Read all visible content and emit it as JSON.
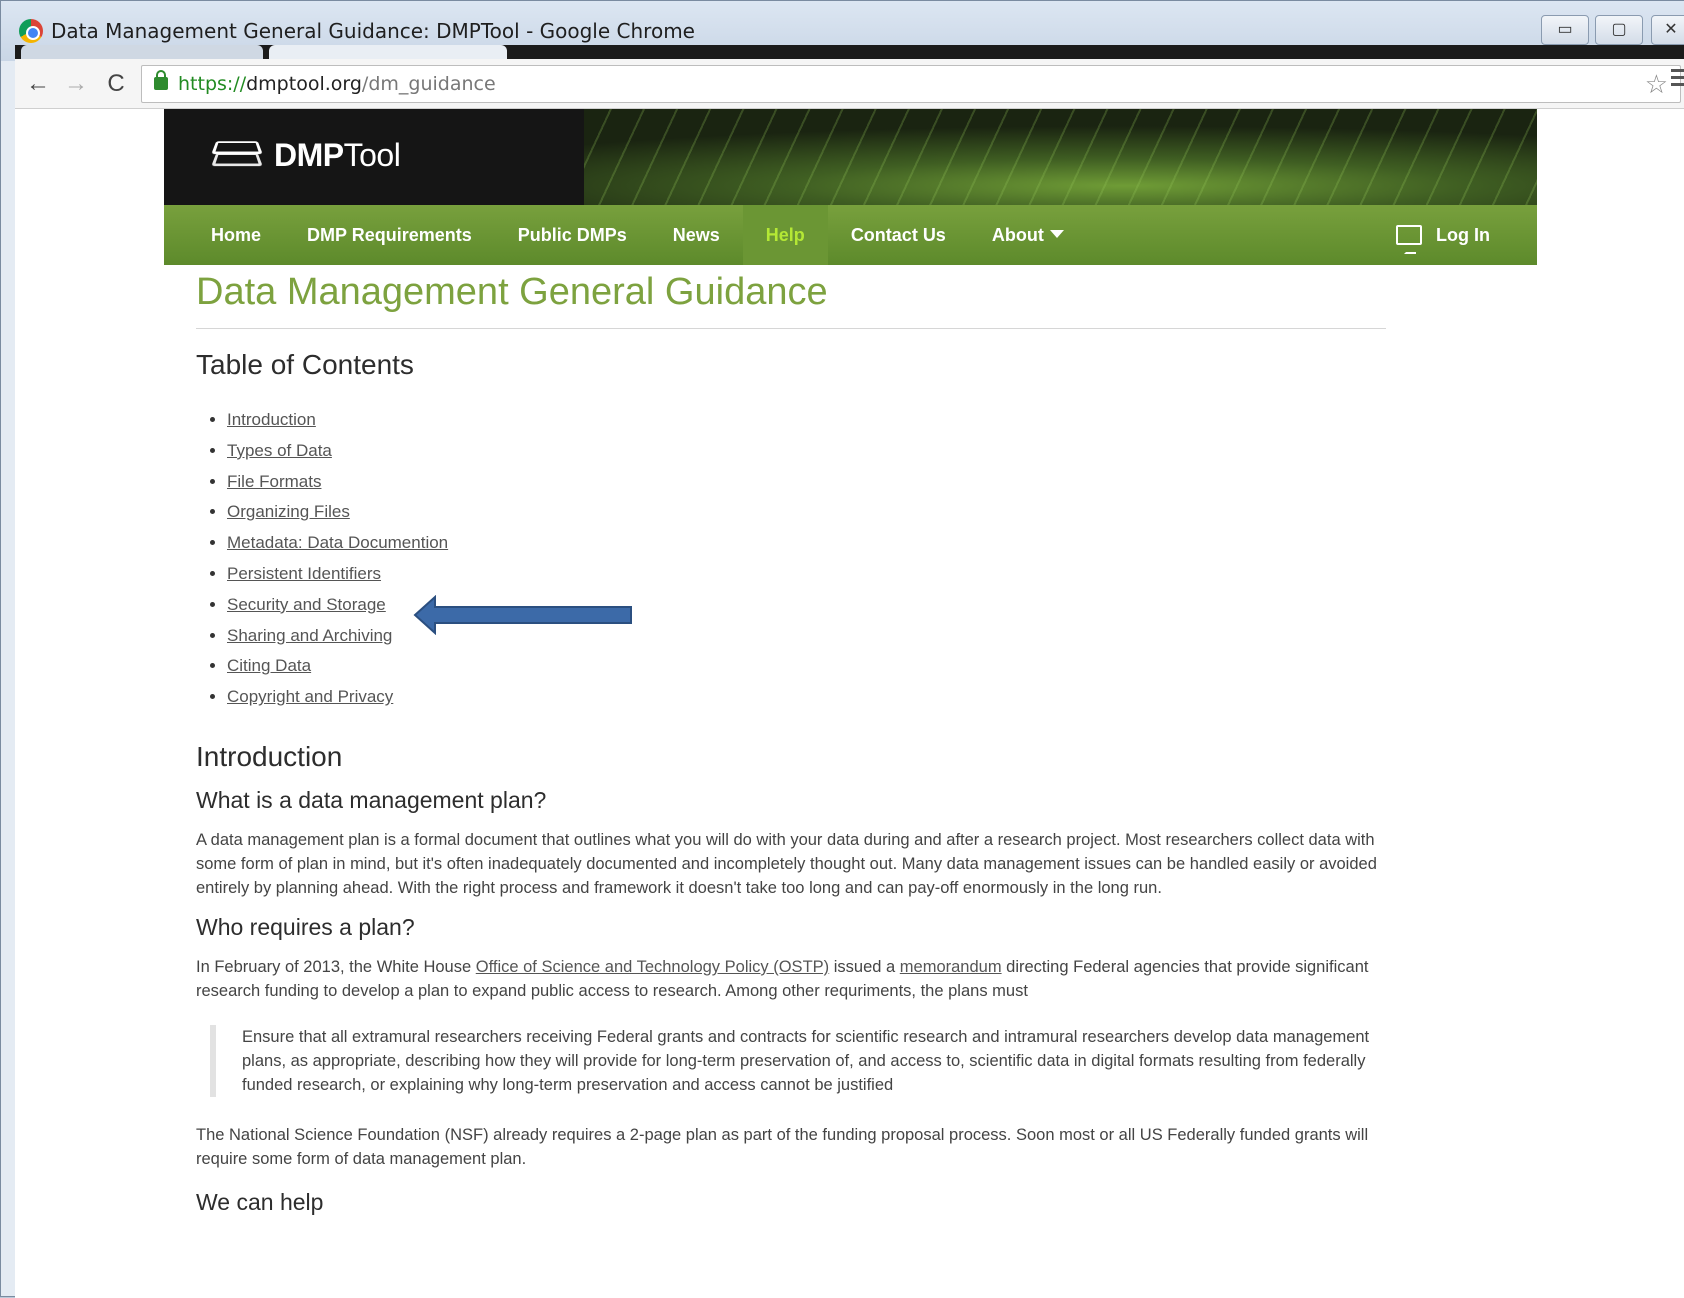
{
  "window": {
    "title": "Data Management General Guidance: DMPTool - Google Chrome",
    "min_glyph": "▭",
    "max_glyph": "▢",
    "close_glyph": "✕"
  },
  "browser": {
    "back_glyph": "←",
    "forward_glyph": "→",
    "reload_glyph": "C",
    "url_scheme": "https://",
    "url_host": "dmptool.org",
    "url_path": "/dm_guidance",
    "star_glyph": "☆"
  },
  "site": {
    "logo_bold": "DMP",
    "logo_light": "Tool",
    "nav": [
      {
        "label": "Home",
        "active": false
      },
      {
        "label": "DMP Requirements",
        "active": false
      },
      {
        "label": "Public DMPs",
        "active": false
      },
      {
        "label": "News",
        "active": false
      },
      {
        "label": "Help",
        "active": true
      },
      {
        "label": "Contact Us",
        "active": false
      },
      {
        "label": "About",
        "active": false
      }
    ],
    "login_label": "Log In"
  },
  "page": {
    "title": "Data Management General Guidance",
    "toc_heading": "Table of Contents",
    "toc": [
      "Introduction",
      "Types of Data",
      "File Formats",
      "Organizing Files",
      "Metadata: Data Documention",
      "Persistent Identifiers",
      "Security and Storage",
      "Sharing and Archiving",
      "Citing Data",
      "Copyright and Privacy"
    ],
    "intro_heading": "Introduction",
    "q1_heading": "What is a data management plan?",
    "q1_text": "A data management plan is a formal document that outlines what you will do with your data during and after a research project. Most researchers collect data with some form of plan in mind, but it's often inadequately documented and incompletely thought out. Many data management issues can be handled easily or avoided entirely by planning ahead. With the right process and framework it doesn't take too long and can pay-off enormously in the long run.",
    "q2_heading": "Who requires a plan?",
    "q2_text_a": "In February of 2013, the White House ",
    "q2_link_ostp": "Office of Science and Technology Policy (OSTP)",
    "q2_text_b": " issued a ",
    "q2_link_memo": "memorandum",
    "q2_text_c": " directing Federal agencies that provide significant research funding to develop a plan to expand public access to research. Among other requriments, the plans must",
    "quote": "Ensure that all extramural researchers receiving Federal grants and contracts for scientific research and intramural researchers develop data management plans, as appropriate, describing how they will provide for long-term preservation of, and access to, scientific data in digital formats resulting from federally funded research, or explaining why long-term preservation and access cannot be justified",
    "nsf_text": "The National Science Foundation (NSF) already requires a 2-page plan as part of the funding proposal process. Soon most or all US Federally funded grants will require some form of data management plan.",
    "help_heading": "We can help"
  },
  "colors": {
    "accent_green": "#7da23f",
    "active_nav": "#b4e835",
    "arrow_fill": "#3c6aa8"
  }
}
